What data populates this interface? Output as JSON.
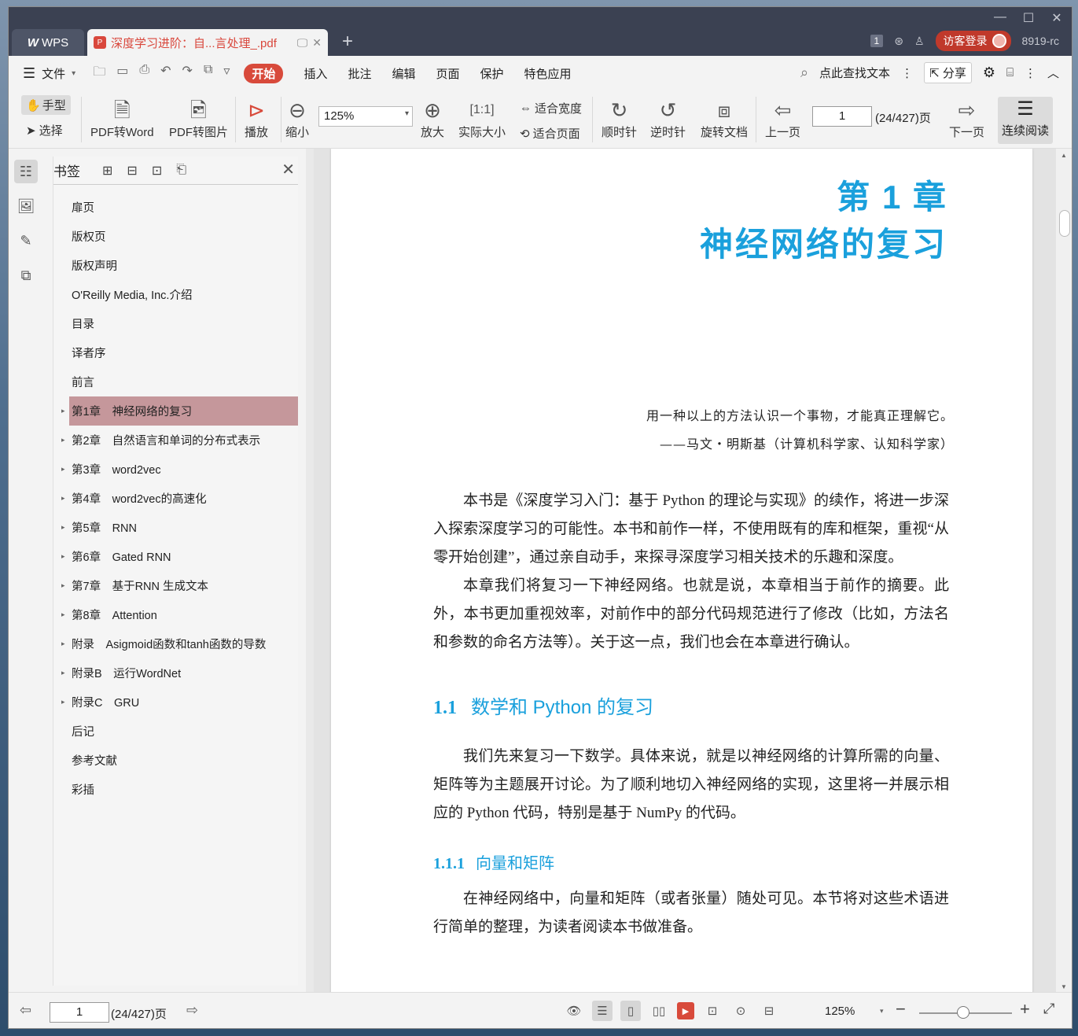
{
  "titlebar": {
    "app_tab": "WPS",
    "doc_tab": "深度学习进阶：自...言处理_.pdf",
    "add_tab": "+",
    "page_badge": "1",
    "guest_login": "访客登录",
    "user_id": "8919-rc",
    "window_controls": [
      "—",
      "☐",
      "✕"
    ]
  },
  "menubar": {
    "file": "文件",
    "tabs": [
      "开始",
      "插入",
      "批注",
      "编辑",
      "页面",
      "保护",
      "特色应用"
    ],
    "search": "点此查找文本",
    "share": "分享"
  },
  "ribbon": {
    "hand": "手型",
    "select": "选择",
    "pdf_to_word": "PDF转Word",
    "pdf_to_image": "PDF转图片",
    "play": "播放",
    "zoom_out": "缩小",
    "zoom_value": "125%",
    "zoom_in": "放大",
    "actual_size": "实际大小",
    "fit_width": "适合宽度",
    "fit_page": "适合页面",
    "clockwise": "顺时针",
    "counterclockwise": "逆时针",
    "rotate_doc": "旋转文档",
    "prev_page": "上一页",
    "page_input": "1",
    "page_total": "(24/427)页",
    "next_page": "下一页",
    "continuous": "连续阅读"
  },
  "bookmarks": {
    "title": "书签",
    "items": [
      {
        "label": "扉页",
        "caret": ""
      },
      {
        "label": "版权页",
        "caret": ""
      },
      {
        "label": "版权声明",
        "caret": ""
      },
      {
        "label": "O'Reilly Media, Inc.介绍",
        "caret": ""
      },
      {
        "label": "目录",
        "caret": ""
      },
      {
        "label": "译者序",
        "caret": ""
      },
      {
        "label": "前言",
        "caret": ""
      },
      {
        "label": "第1章　神经网络的复习",
        "caret": "▸"
      },
      {
        "label": "第2章　自然语言和单词的分布式表示",
        "caret": "▸"
      },
      {
        "label": "第3章　word2vec",
        "caret": "▸"
      },
      {
        "label": "第4章　word2vec的高速化",
        "caret": "▸"
      },
      {
        "label": "第5章　RNN",
        "caret": "▸"
      },
      {
        "label": "第6章　Gated RNN",
        "caret": "▸"
      },
      {
        "label": "第7章　基于RNN 生成文本",
        "caret": "▸"
      },
      {
        "label": "第8章　Attention",
        "caret": "▸"
      },
      {
        "label": "附录　Asigmoid函数和tanh函数的导数",
        "caret": "▸"
      },
      {
        "label": "附录B　运行WordNet",
        "caret": "▸"
      },
      {
        "label": "附录C　GRU",
        "caret": "▸"
      },
      {
        "label": "后记",
        "caret": ""
      },
      {
        "label": "参考文献",
        "caret": ""
      },
      {
        "label": "彩插",
        "caret": ""
      }
    ],
    "selected_index": 7
  },
  "document": {
    "chapter_number": "第 1 章",
    "chapter_title": "神经网络的复习",
    "epigraph_line1": "用一种以上的方法认识一个事物，才能真正理解它。",
    "epigraph_line2": "——马文・明斯基（计算机科学家、认知科学家）",
    "para1": "本书是《深度学习入门：基于 Python 的理论与实现》的续作，将进一步深入探索深度学习的可能性。本书和前作一样，不使用既有的库和框架，重视“从零开始创建”，通过亲自动手，来探寻深度学习相关技术的乐趣和深度。",
    "para2": "本章我们将复习一下神经网络。也就是说，本章相当于前作的摘要。此外，本书更加重视效率，对前作中的部分代码规范进行了修改（比如，方法名和参数的命名方法等）。关于这一点，我们也会在本章进行确认。",
    "section_num": "1.1",
    "section_title": "数学和 Python 的复习",
    "para3": "我们先来复习一下数学。具体来说，就是以神经网络的计算所需的向量、矩阵等为主题展开讨论。为了顺利地切入神经网络的实现，这里将一并展示相应的 Python 代码，特别是基于 NumPy 的代码。",
    "subsection_num": "1.1.1",
    "subsection_title": "向量和矩阵",
    "para4": "在神经网络中，向量和矩阵（或者张量）随处可见。本节将对这些术语进行简单的整理，为读者阅读本书做准备。"
  },
  "statusbar": {
    "page_input": "1",
    "page_total": "(24/427)页",
    "zoom": "125%"
  },
  "colors": {
    "accent_red": "#d84a3b",
    "heading_blue": "#1aa0dc",
    "selected_bookmark": "#c5979b"
  }
}
